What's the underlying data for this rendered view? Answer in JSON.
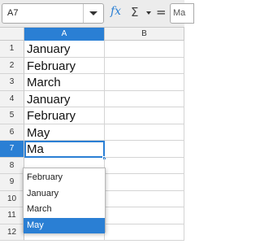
{
  "toolbar": {
    "name_box": "A7",
    "formula_value": "Ma",
    "icons": {
      "function": "fx-icon",
      "sum": "sigma-icon",
      "equals": "equals-icon"
    }
  },
  "columns": [
    "A",
    "B"
  ],
  "active_column": "A",
  "rows": [
    {
      "num": "1",
      "a": "January"
    },
    {
      "num": "2",
      "a": "February"
    },
    {
      "num": "3",
      "a": "March"
    },
    {
      "num": "4",
      "a": "January"
    },
    {
      "num": "5",
      "a": "February"
    },
    {
      "num": "6",
      "a": "May"
    },
    {
      "num": "7",
      "a": "Ma"
    },
    {
      "num": "8",
      "a": ""
    },
    {
      "num": "9",
      "a": ""
    },
    {
      "num": "10",
      "a": ""
    },
    {
      "num": "11",
      "a": ""
    },
    {
      "num": "12",
      "a": ""
    }
  ],
  "active_row": "7",
  "autocomplete": {
    "items": [
      "February",
      "January",
      "March",
      "May"
    ],
    "selected": "May"
  },
  "colors": {
    "accent": "#2a7fd4",
    "header_bg": "#f2f2f2",
    "grid": "#d4d4d4"
  }
}
